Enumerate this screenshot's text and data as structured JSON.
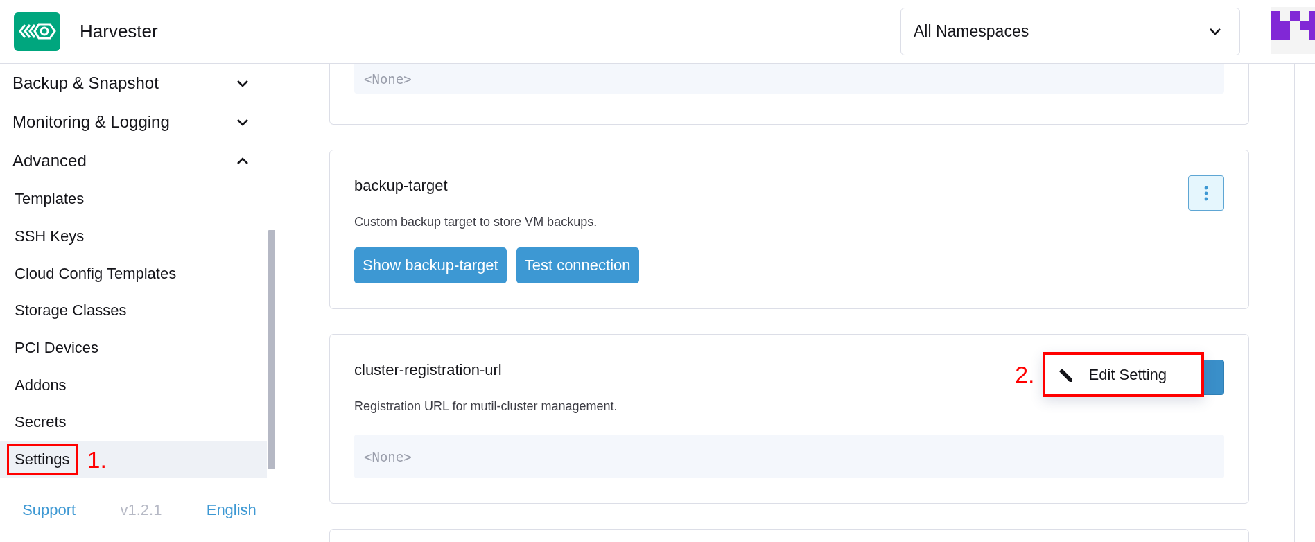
{
  "header": {
    "app_name": "Harvester",
    "namespace_select": {
      "value": "All Namespaces"
    }
  },
  "sidebar": {
    "groups": [
      {
        "label": "Backup & Snapshot",
        "expanded": false
      },
      {
        "label": "Monitoring & Logging",
        "expanded": false
      },
      {
        "label": "Advanced",
        "expanded": true,
        "children": [
          {
            "label": "Templates",
            "selected": false
          },
          {
            "label": "SSH Keys",
            "selected": false
          },
          {
            "label": "Cloud Config Templates",
            "selected": false
          },
          {
            "label": "Storage Classes",
            "selected": false
          },
          {
            "label": "PCI Devices",
            "selected": false
          },
          {
            "label": "Addons",
            "selected": false
          },
          {
            "label": "Secrets",
            "selected": false
          },
          {
            "label": "Settings",
            "selected": true,
            "annotation": "1."
          }
        ]
      }
    ],
    "footer": {
      "support": "Support",
      "version": "v1.2.1",
      "language": "English"
    }
  },
  "settings": [
    {
      "kind": "value",
      "cut": true,
      "value": "<None>"
    },
    {
      "kind": "actions",
      "name": "backup-target",
      "description": "Custom backup target to store VM backups.",
      "menu_open": false,
      "buttons": [
        "Show backup-target",
        "Test connection"
      ]
    },
    {
      "kind": "value",
      "cut": false,
      "name": "cluster-registration-url",
      "description": "Registration URL for mutil-cluster management.",
      "value": "<None>",
      "menu_open": true,
      "menu": [
        {
          "label": "Edit Setting",
          "annotation": "2."
        }
      ]
    },
    {
      "kind": "empty"
    }
  ]
}
